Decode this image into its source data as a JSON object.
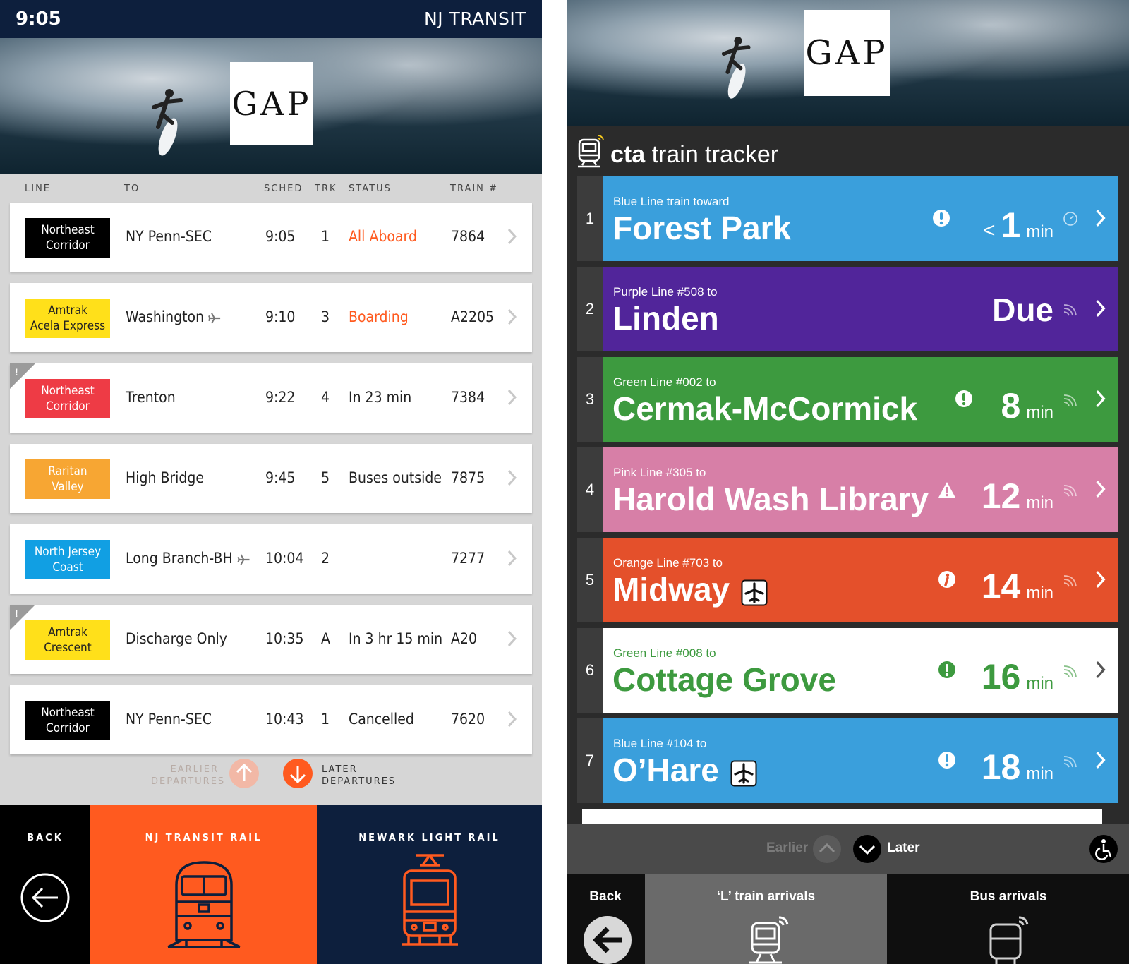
{
  "nj": {
    "time": "9:05",
    "brand": "NJ TRANSIT",
    "ad_logo": "GAP",
    "columns": {
      "line": "LINE",
      "to": "TO",
      "sched": "SCHED",
      "trk": "TRK",
      "status": "STATUS",
      "train": "TRAIN #"
    },
    "rows": [
      {
        "line1": "Northeast",
        "line2": "Corridor",
        "badge_bg": "#000000",
        "badge_fg": "#ffffff",
        "to": "NY Penn-SEC",
        "plane": false,
        "sched": "9:05",
        "trk": "1",
        "status": "All Aboard",
        "status_color": "#ff5a1f",
        "train": "7864",
        "alert": false
      },
      {
        "line1": "Amtrak",
        "line2": "Acela Express",
        "badge_bg": "#ffe01a",
        "badge_fg": "#222222",
        "to": "Washington",
        "plane": true,
        "sched": "9:10",
        "trk": "3",
        "status": "Boarding",
        "status_color": "#ff5a1f",
        "train": "A2205",
        "alert": false
      },
      {
        "line1": "Northeast",
        "line2": "Corridor",
        "badge_bg": "#ee3b45",
        "badge_fg": "#ffffff",
        "to": "Trenton",
        "plane": false,
        "sched": "9:22",
        "trk": "4",
        "status": "In 23 min",
        "status_color": "#222222",
        "train": "7384",
        "alert": true
      },
      {
        "line1": "Raritan",
        "line2": "Valley",
        "badge_bg": "#f7a633",
        "badge_fg": "#ffffff",
        "to": "High Bridge",
        "plane": false,
        "sched": "9:45",
        "trk": "5",
        "status": "Buses outside",
        "status_color": "#222222",
        "train": "7875",
        "alert": false
      },
      {
        "line1": "North Jersey",
        "line2": "Coast",
        "badge_bg": "#119fe3",
        "badge_fg": "#ffffff",
        "to": "Long Branch-BH",
        "plane": true,
        "sched": "10:04",
        "trk": "2",
        "status": "",
        "status_color": "#222222",
        "train": "7277",
        "alert": false
      },
      {
        "line1": "Amtrak",
        "line2": "Crescent",
        "badge_bg": "#ffe01a",
        "badge_fg": "#222222",
        "to": "Discharge Only",
        "plane": false,
        "sched": "10:35",
        "trk": "A",
        "status": "In 3 hr 15 min",
        "status_color": "#222222",
        "train": "A20",
        "alert": true
      },
      {
        "line1": "Northeast",
        "line2": "Corridor",
        "badge_bg": "#000000",
        "badge_fg": "#ffffff",
        "to": "NY Penn-SEC",
        "plane": false,
        "sched": "10:43",
        "trk": "1",
        "status": "Cancelled",
        "status_color": "#222222",
        "train": "7620",
        "alert": false
      }
    ],
    "earlier_1": "EARLIER",
    "earlier_2": "DEPARTURES",
    "later_1": "LATER",
    "later_2": "DEPARTURES",
    "nav": {
      "back": "BACK",
      "rail": "NJ TRANSIT RAIL",
      "light_rail": "NEWARK LIGHT RAIL"
    },
    "colors": {
      "navy": "#0d1f3d",
      "orange": "#ff5a1f"
    }
  },
  "cta": {
    "ad_logo": "GAP",
    "title_bold": "cta",
    "title_rest": " train tracker",
    "rows": [
      {
        "num": "1",
        "sub": "Blue Line train toward",
        "dest": "Forest Park",
        "eta_prefix": "<",
        "eta": "1",
        "unit": "min",
        "bg": "#3a9fdc",
        "fg": "#ffffff",
        "alert": "exclaim",
        "airport": false,
        "signal": "clock"
      },
      {
        "num": "2",
        "sub": "Purple Line #508 to",
        "dest": "Linden",
        "eta_prefix": "",
        "eta": "Due",
        "unit": "",
        "bg": "#51259a",
        "fg": "#ffffff",
        "alert": "",
        "airport": false,
        "signal": "wifi"
      },
      {
        "num": "3",
        "sub": "Green Line #002 to",
        "dest": "Cermak-McCormick",
        "eta_prefix": "",
        "eta": "8",
        "unit": "min",
        "bg": "#3d9a3f",
        "fg": "#ffffff",
        "alert": "exclaim",
        "airport": false,
        "signal": "wifi"
      },
      {
        "num": "4",
        "sub": "Pink Line #305 to",
        "dest": "Harold Wash Library",
        "eta_prefix": "",
        "eta": "12",
        "unit": "min",
        "bg": "#d77fa7",
        "fg": "#ffffff",
        "alert": "warning",
        "airport": false,
        "signal": "wifi"
      },
      {
        "num": "5",
        "sub": "Orange Line #703 to",
        "dest": "Midway",
        "eta_prefix": "",
        "eta": "14",
        "unit": "min",
        "bg": "#e4502b",
        "fg": "#ffffff",
        "alert": "info",
        "airport": true,
        "signal": "wifi"
      },
      {
        "num": "6",
        "sub": "Green Line #008 to",
        "dest": "Cottage Grove",
        "eta_prefix": "",
        "eta": "16",
        "unit": "min",
        "bg": "#ffffff",
        "fg": "#3d9a3f",
        "alert": "exclaim",
        "airport": false,
        "signal": "wifi"
      },
      {
        "num": "7",
        "sub": "Blue Line #104 to",
        "dest": "O’Hare",
        "eta_prefix": "",
        "eta": "18",
        "unit": "min",
        "bg": "#3a9fdc",
        "fg": "#ffffff",
        "alert": "exclaim",
        "airport": true,
        "signal": "wifi"
      }
    ],
    "earlier": "Earlier",
    "later": "Later",
    "nav": {
      "back": "Back",
      "l_train": "‘L’ train arrivals",
      "bus": "Bus arrivals"
    }
  }
}
